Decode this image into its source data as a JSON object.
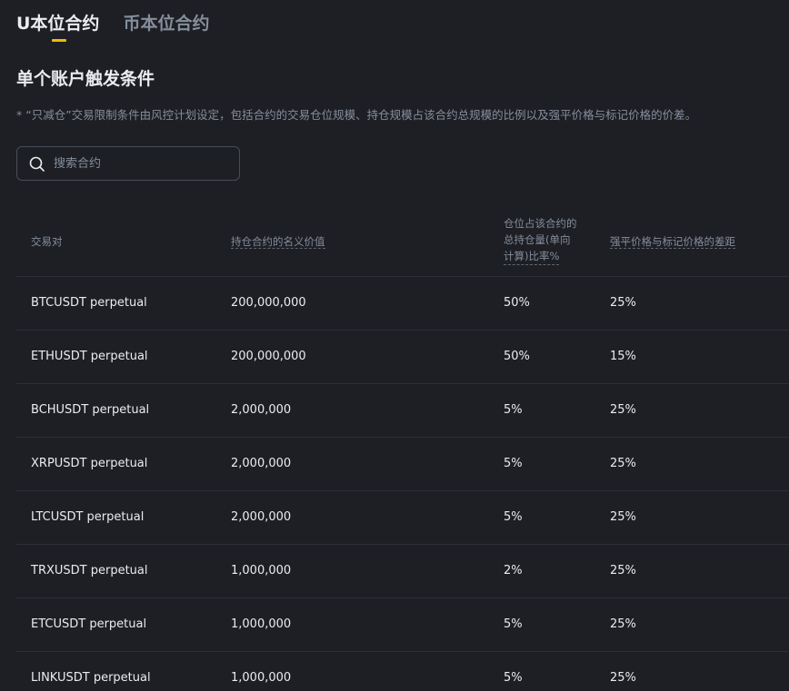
{
  "tabs": [
    {
      "label": "U本位合约",
      "active": true
    },
    {
      "label": "币本位合约",
      "active": false
    }
  ],
  "section_title": "单个账户触发条件",
  "note": "* “只减仓”交易限制条件由风控计划设定，包括合约的交易仓位规模、持仓规模占该合约总规模的比例以及强平价格与标记价格的价差。",
  "search": {
    "placeholder": "搜索合约",
    "value": ""
  },
  "table": {
    "headers": {
      "pair": "交易对",
      "notional": "持仓合约的名义价值",
      "ratio_line1": "仓位占该合约的",
      "ratio_line2": "总持仓量(单向",
      "ratio_line3": "计算)比率%",
      "diff": "强平价格与标记价格的差距"
    },
    "rows": [
      {
        "pair": "BTCUSDT perpetual",
        "notional": "200,000,000",
        "ratio": "50%",
        "diff": "25%"
      },
      {
        "pair": "ETHUSDT perpetual",
        "notional": "200,000,000",
        "ratio": "50%",
        "diff": "15%"
      },
      {
        "pair": "BCHUSDT perpetual",
        "notional": "2,000,000",
        "ratio": "5%",
        "diff": "25%"
      },
      {
        "pair": "XRPUSDT perpetual",
        "notional": "2,000,000",
        "ratio": "5%",
        "diff": "25%"
      },
      {
        "pair": "LTCUSDT perpetual",
        "notional": "2,000,000",
        "ratio": "5%",
        "diff": "25%"
      },
      {
        "pair": "TRXUSDT perpetual",
        "notional": "1,000,000",
        "ratio": "2%",
        "diff": "25%"
      },
      {
        "pair": "ETCUSDT perpetual",
        "notional": "1,000,000",
        "ratio": "5%",
        "diff": "25%"
      },
      {
        "pair": "LINKUSDT perpetual",
        "notional": "1,000,000",
        "ratio": "5%",
        "diff": "25%"
      }
    ]
  },
  "colors": {
    "background": "#1e1f24",
    "accent": "#f0b90b",
    "text_primary": "#eaecef",
    "text_secondary": "#848e9c",
    "divider": "#2b2f36"
  },
  "icons": {
    "search": "search-icon"
  }
}
